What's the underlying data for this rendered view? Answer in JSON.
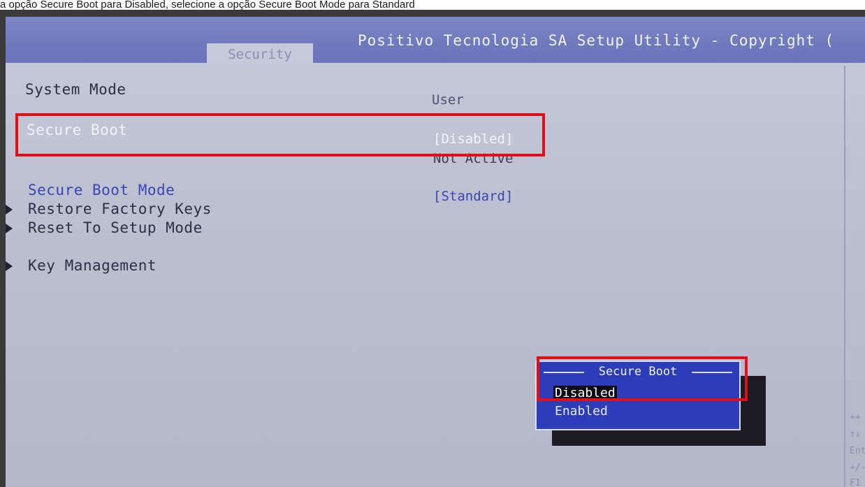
{
  "caption": "a opção Secure Boot para Disabled, selecione a opção Secure Boot Mode para Standard",
  "header": {
    "title": "Positivo Tecnologia SA Setup Utility - Copyright (",
    "tab": "Security"
  },
  "rows": {
    "system_mode": {
      "label": "System Mode",
      "value": "User"
    },
    "secure_boot": {
      "label": "Secure Boot",
      "value": "[Disabled]",
      "status": "Not Active"
    },
    "secure_boot_mode": {
      "label": "Secure Boot Mode",
      "value": "[Standard]"
    },
    "restore_factory_keys": {
      "label": "Restore Factory Keys"
    },
    "reset_to_setup_mode": {
      "label": "Reset To Setup Mode"
    },
    "key_management": {
      "label": "Key Management"
    }
  },
  "popup": {
    "title": "Secure Boot",
    "options": [
      "Disabled",
      "Enabled"
    ],
    "selected": "Disabled"
  },
  "help": [
    "++",
    "↑↓",
    "Ent",
    "+/-",
    "F1"
  ],
  "colors": {
    "header": "#6f79bd",
    "background": "#bcc0d0",
    "popup": "#2d3db8",
    "highlight": "#e0101a",
    "link_blue": "#3b45b6"
  }
}
